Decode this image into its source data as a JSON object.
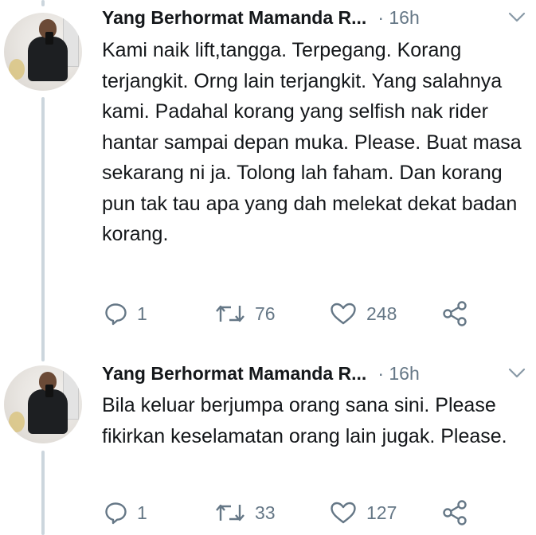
{
  "tweets": [
    {
      "author": "Yang Berhormat Mamanda R...",
      "time": "· 16h",
      "text": "Kami naik lift,tangga. Terpegang. Korang terjangkit. Orng lain terjangkit. Yang salahnya kami. Padahal korang yang selfish nak rider hantar sampai depan muka. Please. Buat masa sekarang ni ja. Tolong lah faham. Dan korang pun tak tau apa yang dah melekat dekat badan korang.",
      "replies": "1",
      "retweets": "76",
      "likes": "248"
    },
    {
      "author": "Yang Berhormat Mamanda R...",
      "time": "· 16h",
      "text": "Bila keluar berjumpa orang sana sini. Please fikirkan keselamatan orang lain jugak. Please.",
      "replies": "1",
      "retweets": "33",
      "likes": "127"
    }
  ],
  "icons": {
    "reply": "reply-icon",
    "retweet": "retweet-icon",
    "like": "like-icon",
    "share": "share-icon",
    "menu": "chevron-down-icon"
  },
  "colors": {
    "text": "#14171a",
    "secondary": "#657786",
    "thread_line": "#ccd6dd"
  }
}
